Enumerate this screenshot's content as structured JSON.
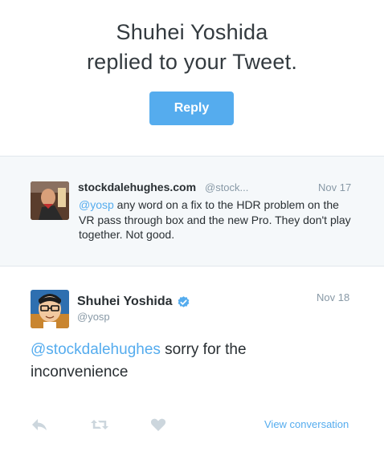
{
  "hero": {
    "title_line1": "Shuhei Yoshida",
    "title_line2": "replied to your Tweet.",
    "reply_button": "Reply"
  },
  "quoted_tweet": {
    "author_name": "stockdalehughes.com",
    "author_handle": "@stock...",
    "date": "Nov 17",
    "mention": "@yosp",
    "text": " any word on a fix to the HDR problem on the VR pass through box and the new Pro. They don't play together. Not good."
  },
  "reply_tweet": {
    "author_name": "Shuhei Yoshida",
    "author_handle": "@yosp",
    "date": "Nov 18",
    "mention": "@stockdalehughes",
    "text": " sorry for the inconvenience"
  },
  "actions": {
    "reply_icon": "reply-icon",
    "retweet_icon": "retweet-icon",
    "like_icon": "heart-icon",
    "view_conversation": "View conversation"
  },
  "colors": {
    "accent": "#55acee",
    "muted": "#8899a6",
    "quoted_bg": "#f5f8fa",
    "divider": "#e1e8ed"
  }
}
